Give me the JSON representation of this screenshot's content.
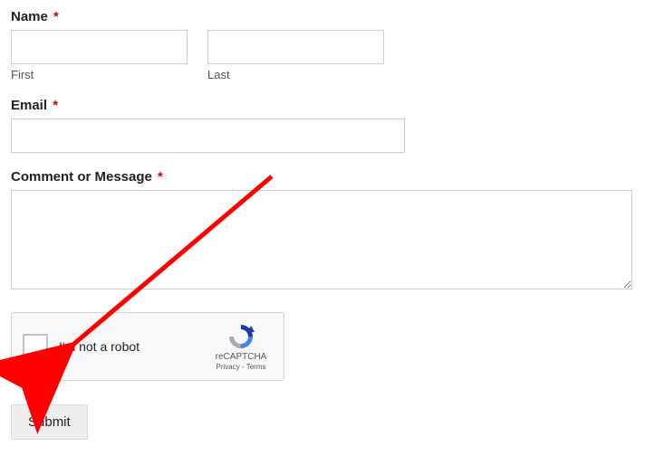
{
  "form": {
    "name": {
      "label": "Name",
      "required_mark": "*",
      "first": {
        "value": "",
        "sublabel": "First"
      },
      "last": {
        "value": "",
        "sublabel": "Last"
      }
    },
    "email": {
      "label": "Email",
      "required_mark": "*",
      "value": ""
    },
    "message": {
      "label": "Comment or Message",
      "required_mark": "*",
      "value": ""
    },
    "recaptcha": {
      "text": "I'm not a robot",
      "brand": "reCAPTCHA",
      "privacy": "Privacy",
      "sep": " - ",
      "terms": "Terms"
    },
    "submit_label": "Submit"
  }
}
